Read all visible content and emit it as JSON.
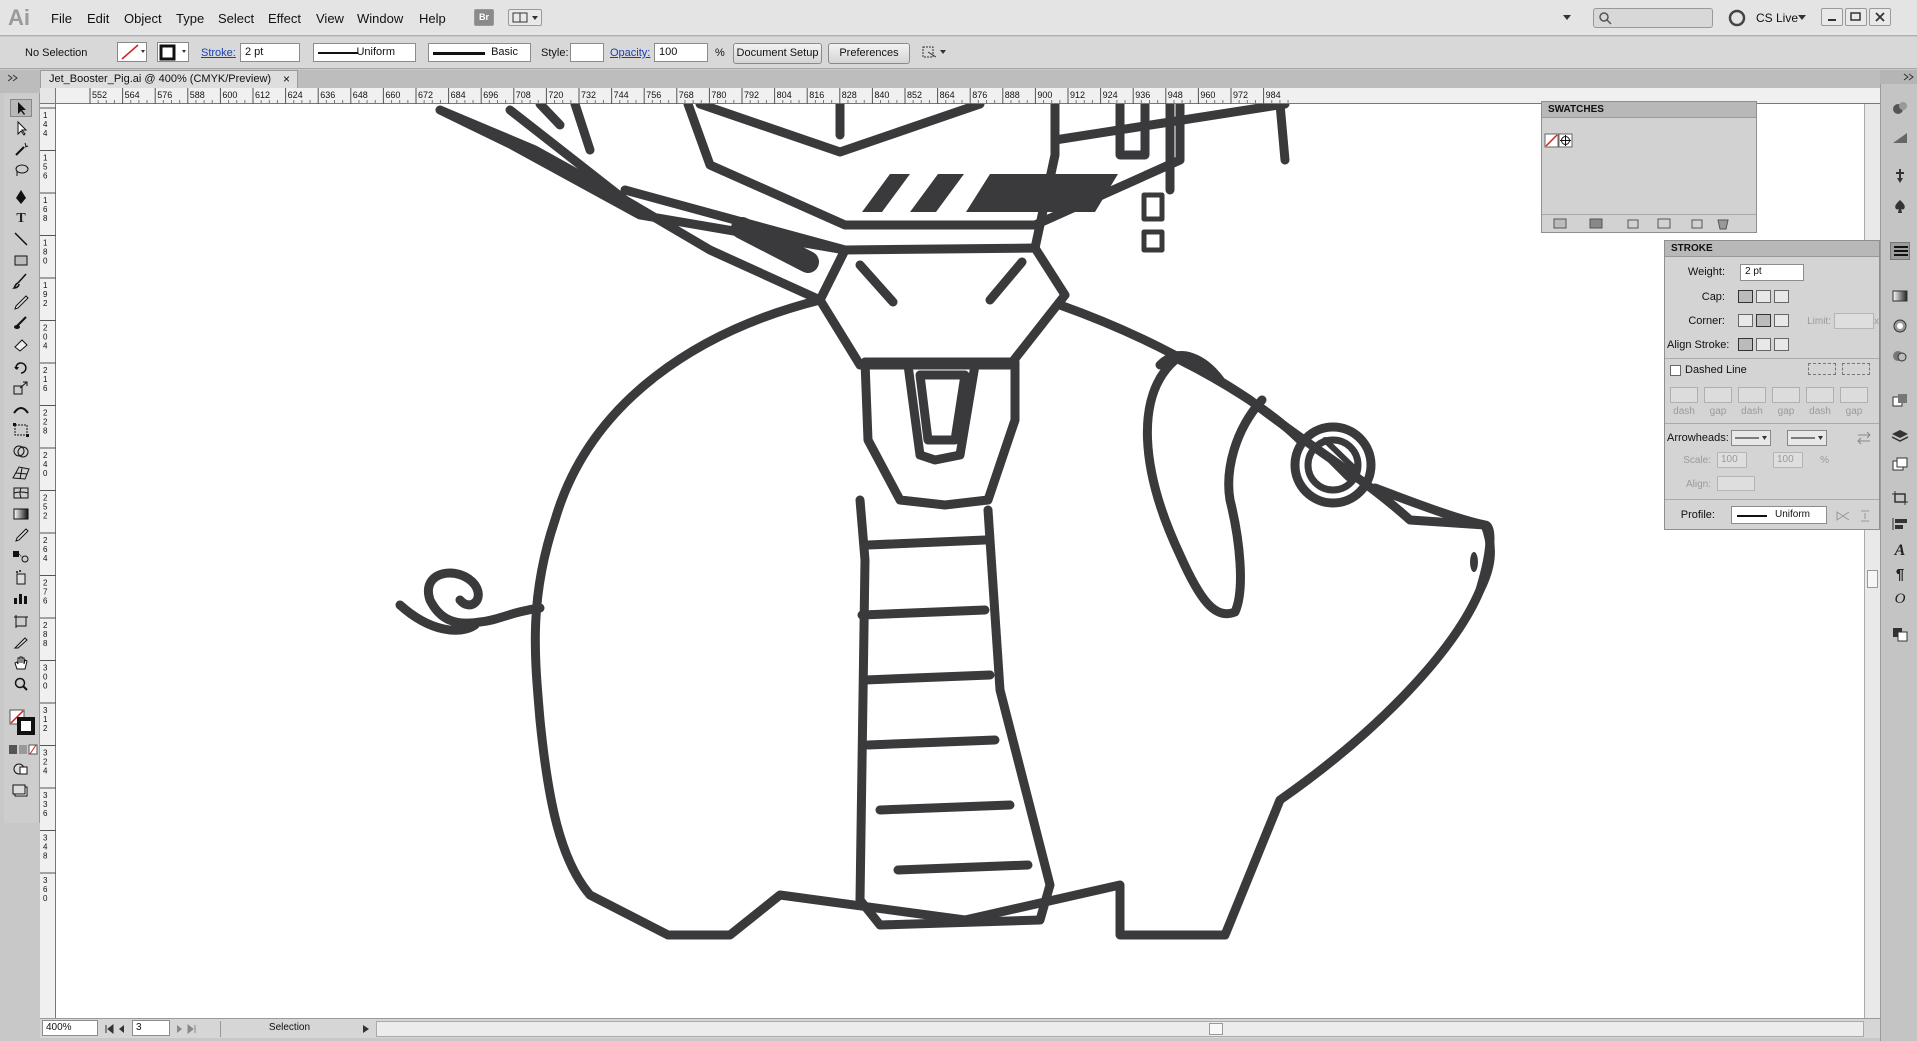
{
  "app": {
    "logo": "Ai"
  },
  "menu": {
    "items": [
      "File",
      "Edit",
      "Object",
      "Type",
      "Select",
      "Effect",
      "View",
      "Window",
      "Help"
    ],
    "br": "Br",
    "cs_live": "CS Live"
  },
  "control_bar": {
    "selection": "No Selection",
    "stroke_label": "Stroke:",
    "stroke_weight": "2 pt",
    "variable_width_profile": "Uniform",
    "brush": "Basic",
    "style_label": "Style:",
    "opacity_label": "Opacity:",
    "opacity_value": "100",
    "opacity_unit": "%",
    "document_setup": "Document Setup",
    "preferences": "Preferences"
  },
  "document_tab": {
    "title": "Jet_Booster_Pig.ai @ 400% (CMYK/Preview)",
    "close": "×"
  },
  "ruler_top": [
    "552",
    "564",
    "576",
    "588",
    "600",
    "612",
    "624",
    "636",
    "648",
    "660",
    "672",
    "684",
    "696",
    "708",
    "720",
    "732",
    "744",
    "756",
    "768",
    "780",
    "792",
    "804",
    "816",
    "828",
    "840",
    "852",
    "864",
    "876",
    "888",
    "900",
    "912",
    "924",
    "936",
    "948",
    "960",
    "972",
    "984"
  ],
  "ruler_left": [
    "1 4 4",
    "1 5 6",
    "1 6 8",
    "1 8 0",
    "1 9 2",
    "2 0 4",
    "2 1 6",
    "2 2 8",
    "2 4 0",
    "2 5 2",
    "2 6 4",
    "2 7 6",
    "2 8 8",
    "3 0 0",
    "3 1 2",
    "3 2 4",
    "3 3 6",
    "3 4 8",
    "3 6 0"
  ],
  "swatches_panel": {
    "title": "SWATCHES"
  },
  "stroke_panel": {
    "title": "STROKE",
    "weight_label": "Weight:",
    "weight_value": "2 pt",
    "cap_label": "Cap:",
    "corner_label": "Corner:",
    "limit_label": "Limit:",
    "limit_suffix": "x",
    "align_label": "Align Stroke:",
    "dashed_label": "Dashed Line",
    "dash_labels": [
      "dash",
      "gap",
      "dash",
      "gap",
      "dash",
      "gap"
    ],
    "arrowheads_label": "Arrowheads:",
    "scale_label": "Scale:",
    "scale_start": "100",
    "scale_end": "100",
    "scale_unit": "%",
    "align_arrow_label": "Align:",
    "profile_label": "Profile:",
    "profile_value": "Uniform"
  },
  "status_bar": {
    "zoom": "400%",
    "artboard": "3",
    "tool": "Selection"
  },
  "colors": {
    "ink": "#3a3a3c",
    "accent_link": "#1a3fb3",
    "fill_none": "#d02020"
  }
}
